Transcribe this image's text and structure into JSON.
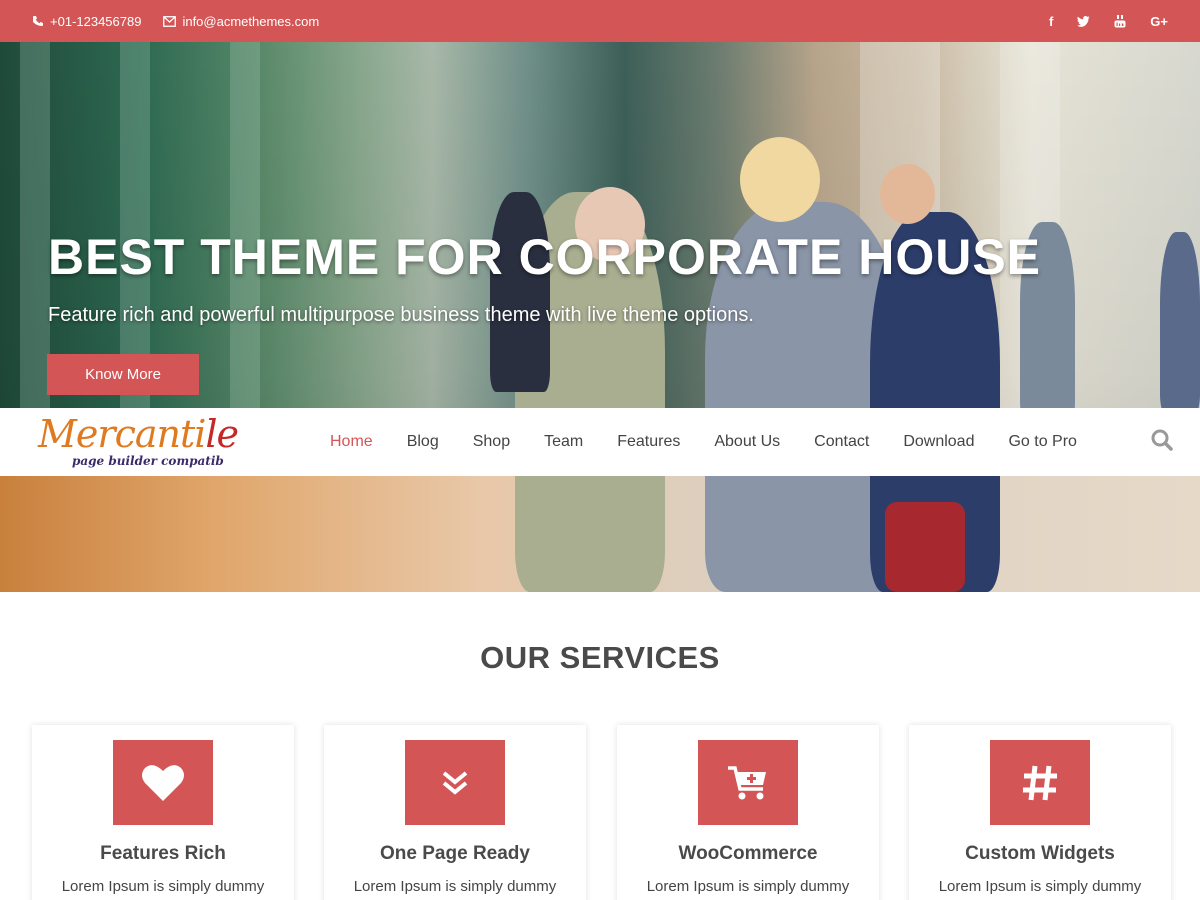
{
  "topbar": {
    "phone": "+01-123456789",
    "email": "info@acmethemes.com",
    "social": [
      {
        "icon": "facebook-icon",
        "glyph": "f"
      },
      {
        "icon": "twitter-icon",
        "glyph": "🐦"
      },
      {
        "icon": "youtube-icon",
        "glyph": "▶"
      },
      {
        "icon": "google-plus-icon",
        "glyph": "G+"
      }
    ]
  },
  "hero": {
    "title": "BEST THEME FOR CORPORATE HOUSE",
    "subtitle": "Feature rich and powerful multipurpose business theme with live theme options.",
    "button_label": "Know More"
  },
  "nav": {
    "logo_main": "Mercanti",
    "logo_tail": "le",
    "logo_tagline": "page builder compatib",
    "items": [
      {
        "label": "Home",
        "active": true
      },
      {
        "label": "Blog"
      },
      {
        "label": "Shop"
      },
      {
        "label": "Team"
      },
      {
        "label": "Features"
      },
      {
        "label": "About Us"
      },
      {
        "label": "Contact"
      },
      {
        "label": "Download"
      },
      {
        "label": "Go to Pro"
      }
    ]
  },
  "services": {
    "title": "OUR SERVICES",
    "cards": [
      {
        "icon": "heart-icon",
        "title": "Features Rich",
        "text": "Lorem Ipsum is simply dummy"
      },
      {
        "icon": "double-chevron-down-icon",
        "title": "One Page Ready",
        "text": "Lorem Ipsum is simply dummy"
      },
      {
        "icon": "cart-plus-icon",
        "title": "WooCommerce",
        "text": "Lorem Ipsum is simply dummy"
      },
      {
        "icon": "hashtag-icon",
        "title": "Custom Widgets",
        "text": "Lorem Ipsum is simply dummy"
      }
    ]
  },
  "colors": {
    "accent": "#d35555",
    "text": "#444444"
  }
}
